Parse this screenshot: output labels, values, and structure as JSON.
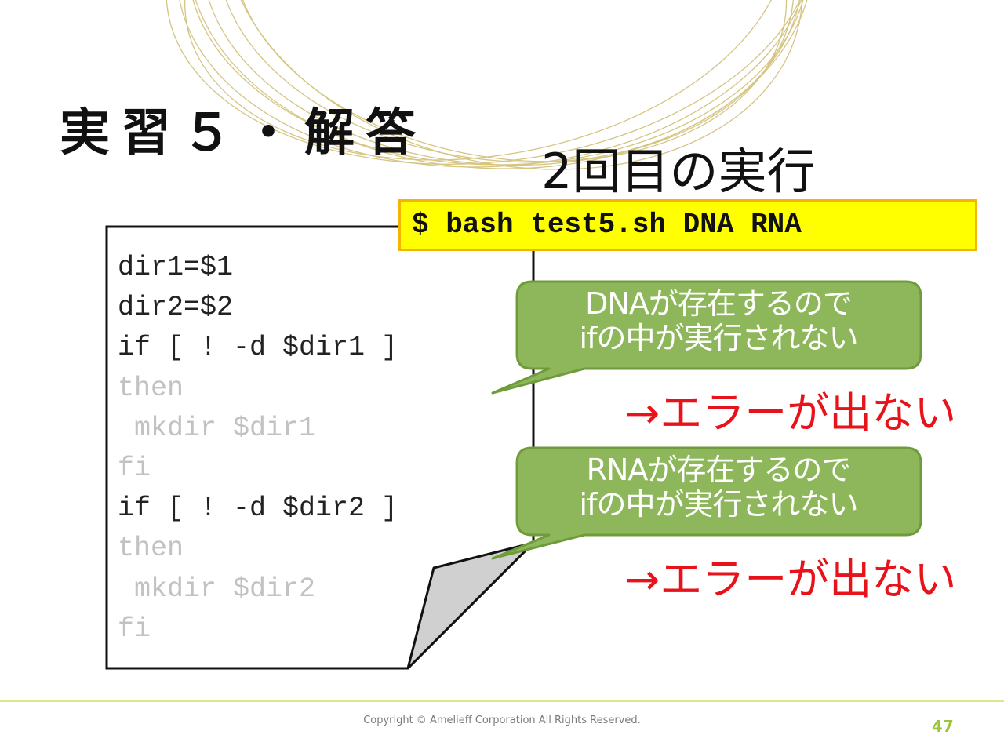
{
  "slide": {
    "title": "実習５・解答",
    "run_label": "2回目の実行",
    "command": "$ bash test5.sh DNA RNA"
  },
  "code": {
    "lines": [
      "dir1=$1",
      "dir2=$2",
      "if [ ! -d $dir1 ]",
      "then",
      " mkdir $dir1",
      "fi",
      "if [ ! -d $dir2 ]",
      "then",
      " mkdir $dir2",
      "fi"
    ],
    "dimmed_lines": [
      3,
      4,
      5,
      7,
      8,
      9
    ]
  },
  "callouts": [
    {
      "line1": "DNAが存在するので",
      "line2": "ifの中が実行されない",
      "result": "→エラーが出ない"
    },
    {
      "line1": "RNAが存在するので",
      "line2": "ifの中が実行されない",
      "result": "→エラーが出ない"
    }
  ],
  "footer": {
    "copyright": "Copyright © Amelieff Corporation All Rights Reserved.",
    "page_number": "47"
  },
  "colors": {
    "command_bg": "#ffff00",
    "command_border": "#f5b400",
    "callout_fill": "#8db75a",
    "callout_stroke": "#6f9b3a",
    "result_text": "#e8121b",
    "code_dim": "#c2c2c2",
    "footer_line": "#d9e88a",
    "page_number": "#9bc43a",
    "ring_stroke": "#c8b25a"
  }
}
